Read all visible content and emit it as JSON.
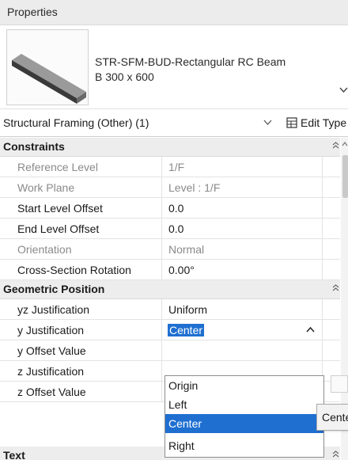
{
  "panel": {
    "title": "Properties"
  },
  "type_selector": {
    "line1": "STR-SFM-BUD-Rectangular RC Beam",
    "line2": "B 300 x 600"
  },
  "category_bar": {
    "filter": "Structural Framing (Other) (1)",
    "edit_type": "Edit Type"
  },
  "groups": {
    "constraints": "Constraints",
    "geometric_position": "Geometric Position",
    "text": "Text"
  },
  "constraints": [
    {
      "name": "Reference Level",
      "value": "1/F",
      "editable": false
    },
    {
      "name": "Work Plane",
      "value": "Level : 1/F",
      "editable": false
    },
    {
      "name": "Start Level Offset",
      "value": "0.0",
      "editable": true
    },
    {
      "name": "End Level Offset",
      "value": "0.0",
      "editable": true
    },
    {
      "name": "Orientation",
      "value": "Normal",
      "editable": false
    },
    {
      "name": "Cross-Section Rotation",
      "value": "0.00°",
      "editable": true
    }
  ],
  "geometric_position": [
    {
      "name": "yz Justification",
      "value": "Uniform"
    },
    {
      "name": "y Justification",
      "value": "Center"
    },
    {
      "name": "y Offset Value",
      "value": ""
    },
    {
      "name": "z Justification",
      "value": ""
    },
    {
      "name": "z Offset Value",
      "value": ""
    }
  ],
  "dropdown": {
    "options": [
      "Origin",
      "Left",
      "Center",
      "Right"
    ],
    "highlighted": "Center"
  },
  "tooltip": {
    "text": "Center"
  },
  "colors": {
    "selection": "#1f6fd1",
    "group_bg": "#ededed"
  }
}
